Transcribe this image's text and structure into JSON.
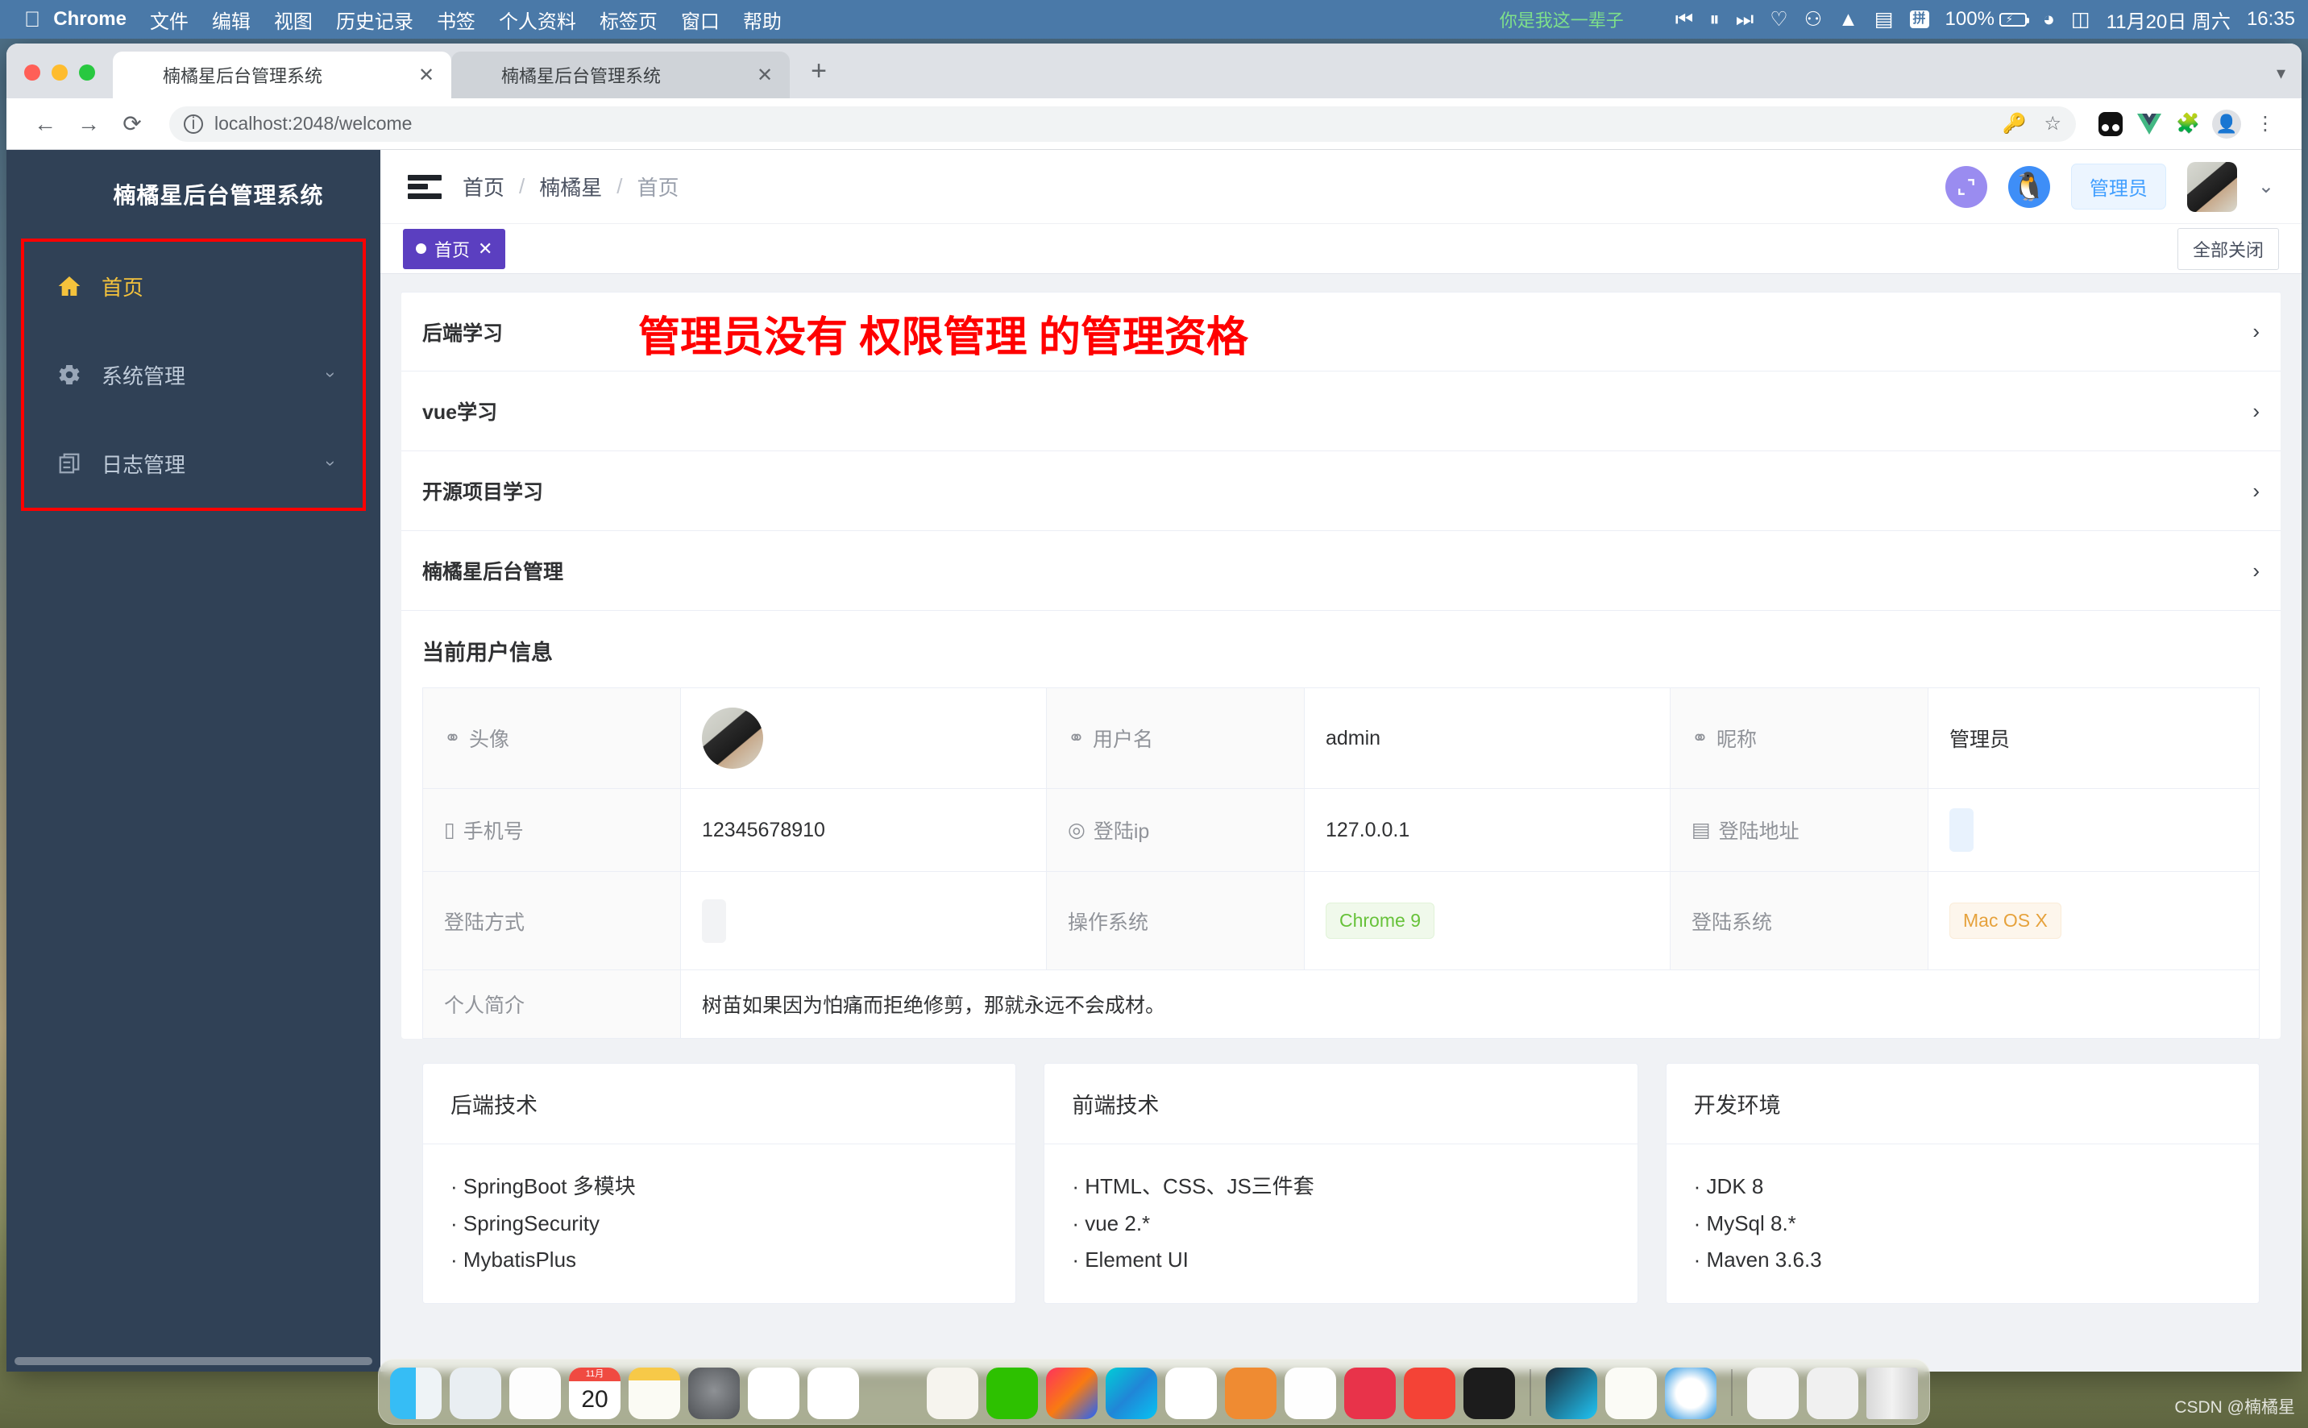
{
  "menubar": {
    "apple_icon": "apple-icon",
    "items": [
      "Chrome",
      "文件",
      "编辑",
      "视图",
      "历史记录",
      "书签",
      "个人资料",
      "标签页",
      "窗口",
      "帮助"
    ],
    "song_title": "你是我这一辈子",
    "media_controls": [
      "prev-track-icon",
      "pause-icon",
      "next-track-icon",
      "heart-icon",
      "airdrop-icon",
      "notification-icon"
    ],
    "ime_label": "拼",
    "battery_percent": "100%",
    "wifi_icon": "wifi-icon",
    "controlcenter_icon": "control-center-icon",
    "date": "11月20日 周六",
    "time": "16:35"
  },
  "browser": {
    "tabs": [
      {
        "title": "楠橘星后台管理系统",
        "close": "✕",
        "active": true
      },
      {
        "title": "楠橘星后台管理系统",
        "close": "✕",
        "active": false
      }
    ],
    "new_tab_label": "+",
    "back_icon": "←",
    "forward_icon": "→",
    "reload_icon": "⟳",
    "site_info_icon": "ⓘ",
    "url": "localhost:2048/welcome",
    "key_icon": "key-icon",
    "star_icon": "☆",
    "extensions": [
      "pocket-icon",
      "vue-devtools-icon",
      "puzzle-icon"
    ],
    "profile_icon": "profile-icon",
    "menu_icon": "⋮"
  },
  "sidebar": {
    "brand": "楠橘星后台管理系统",
    "items": [
      {
        "label": "首页",
        "icon": "home-icon",
        "active": true,
        "expandable": false
      },
      {
        "label": "系统管理",
        "icon": "gear-icon",
        "active": false,
        "expandable": true
      },
      {
        "label": "日志管理",
        "icon": "document-copy-icon",
        "active": false,
        "expandable": true
      }
    ]
  },
  "appheader": {
    "hamburger_icon": "collapse-menu-icon",
    "breadcrumb": [
      "首页",
      "楠橘星",
      "首页"
    ],
    "breadcrumb_sep": "/",
    "fullscreen_icon": "fullscreen-icon",
    "github_icon": "github-icon",
    "role_tag": "管理员",
    "avatar_icon": "user-avatar",
    "caret_icon": "chevron-down-icon"
  },
  "tagsbar": {
    "tags": [
      {
        "label": "首页",
        "close": "✕"
      }
    ],
    "close_all_label": "全部关闭"
  },
  "error_overlay": {
    "message": "管理员没有 权限管理 的管理资格",
    "color": "#ff0000"
  },
  "collapse": {
    "items": [
      {
        "label": "后端学习",
        "chevron": "›"
      },
      {
        "label": "vue学习",
        "chevron": "›"
      },
      {
        "label": "开源项目学习",
        "chevron": "›"
      },
      {
        "label": "楠橘星后台管理",
        "chevron": "›"
      }
    ]
  },
  "userinfo": {
    "title": "当前用户信息",
    "rows": [
      [
        {
          "label": "头像",
          "icon": "user-icon",
          "value": "",
          "type": "avatar"
        },
        {
          "label": "用户名",
          "icon": "user-icon",
          "value": "admin",
          "type": "text"
        },
        {
          "label": "昵称",
          "icon": "user-icon",
          "value": "管理员",
          "type": "text"
        }
      ],
      [
        {
          "label": "手机号",
          "icon": "phone-icon",
          "value": "12345678910",
          "type": "text"
        },
        {
          "label": "登陆ip",
          "icon": "location-icon",
          "value": "127.0.0.1",
          "type": "text"
        },
        {
          "label": "登陆地址",
          "icon": "list-icon",
          "value": "",
          "type": "skeleton-blue"
        }
      ],
      [
        {
          "label": "登陆方式",
          "icon": "",
          "value": "",
          "type": "skeleton"
        },
        {
          "label": "操作系统",
          "icon": "",
          "value": "Chrome 9",
          "type": "badge-green"
        },
        {
          "label": "登陆系统",
          "icon": "",
          "value": "Mac OS X",
          "type": "badge-orange"
        }
      ]
    ],
    "bio_label": "个人简介",
    "bio_value": "树苗如果因为怕痛而拒绝修剪，那就永远不会成材。"
  },
  "cards": [
    {
      "title": "后端技术",
      "items": [
        "· SpringBoot 多模块",
        "· SpringSecurity",
        "· MybatisPlus"
      ]
    },
    {
      "title": "前端技术",
      "items": [
        "· HTML、CSS、JS三件套",
        "· vue 2.*",
        "· Element UI"
      ]
    },
    {
      "title": "开发环境",
      "items": [
        "· JDK 8",
        "· MySql 8.*",
        "· Maven 3.6.3"
      ]
    }
  ],
  "dock": {
    "apps": [
      "finder",
      "launchpad",
      "photos",
      "calendar",
      "notes",
      "system-preferences",
      "music",
      "chrome",
      "qq",
      "typora",
      "wechat",
      "intellij-idea",
      "webstorm",
      "vscode",
      "sublime",
      "postman",
      "firefox-dev",
      "books",
      "terminal",
      "xmind",
      "pages",
      "safari",
      "folder-stack",
      "excel-doc",
      "trash"
    ],
    "calendar_month": "11月",
    "calendar_day": "20"
  },
  "watermark": "CSDN @楠橘星"
}
